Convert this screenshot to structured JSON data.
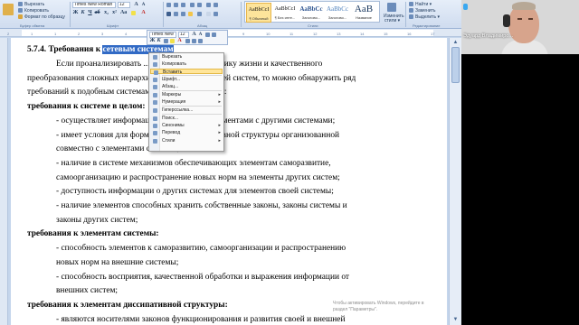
{
  "ribbon": {
    "clipboard": {
      "cut": "Вырезать",
      "copy": "Копировать",
      "format_painter": "Формат по образцу",
      "group": "Буфер обмена"
    },
    "font": {
      "name": "Times New Roman",
      "size": "12",
      "group": "Шрифт"
    },
    "paragraph_group": "Абзац",
    "styles": {
      "tiles": [
        {
          "sample": "AaBbCcI",
          "name": "¶ Обычный",
          "active": true
        },
        {
          "sample": "AaBbCcI",
          "name": "¶ Без инте..."
        },
        {
          "sample": "AaBbCc",
          "name": "Заголово..."
        },
        {
          "sample": "AaBbCc",
          "name": "Заголово..."
        },
        {
          "sample": "AaB",
          "name": "Название"
        }
      ],
      "group": "Стили"
    },
    "change_styles": {
      "line1": "Изменить",
      "line2": "стили ▾"
    },
    "editing": {
      "find": "Найти ▾",
      "replace": "Заменить",
      "select": "Выделить ▾",
      "group": "Редактирование"
    }
  },
  "ruler_marks": [
    "2",
    "1",
    "1",
    "2",
    "3",
    "4",
    "5",
    "6",
    "7",
    "8",
    "9",
    "10",
    "11",
    "12",
    "13",
    "14",
    "15",
    "16",
    "17"
  ],
  "document": {
    "heading_prefix": "5.7.4. Требования к ",
    "heading_selected": "сетевым системам",
    "lines": [
      {
        "text": "Если   проанализировать  ...   организации,   динамику  жизни  и  качественного",
        "indent": true
      },
      {
        "text": "преобразования сложных иерархических систем и сетей систем, то можно обнаружить ряд"
      },
      {
        "text": "требований к подобным системам и их составляющим:"
      },
      {
        "text": "требования к системе в целом:",
        "bold": true
      },
      {
        "text": "- осуществляет информационный и обмен элементами с другими системами;",
        "indent": true
      },
      {
        "text": "-  имеет  условия  для  формирования  диссипативной  структуры  организованной",
        "indent": true
      },
      {
        "text": "совместно с элементами системы;",
        "indent": true
      },
      {
        "text": "-   наличие   в   системе   механизмов   обеспечивающих   элементам   саморазвитие,",
        "indent": true
      },
      {
        "text": "самоорганизацию и распространение новых норм на элементы других систем;",
        "indent": true
      },
      {
        "text": "- доступность информации о других системах для элементов своей системы;",
        "indent": true
      },
      {
        "text": "-  наличие  элементов  способных  хранить  собственные  законы,  законы  системы  и",
        "indent": true
      },
      {
        "text": "законы других систем;",
        "indent": true
      },
      {
        "text": "требования  к элементам системы:",
        "bold": true
      },
      {
        "text": "-  способность  элементов  к  саморазвитию,  самоорганизации  и  распространению",
        "indent": true
      },
      {
        "text": "новых норм на внешние системы;",
        "indent": true
      },
      {
        "text": "-  способность  восприятия,  качественной  обработки  и  выражения  информации  от",
        "indent": true
      },
      {
        "text": "внешних систем;",
        "indent": true
      },
      {
        "text": "требования  к элементам диссипативной структуры:",
        "bold": true
      },
      {
        "text": "-  являются  носителями  законов  функционирования  и  развития  своей  и  внешней",
        "indent": true
      },
      {
        "text": "системы (систем);",
        "indent": true
      }
    ]
  },
  "mini_toolbar": {
    "font": "Times New",
    "size": "12"
  },
  "context_menu": {
    "items": [
      {
        "label": "Вырезать"
      },
      {
        "label": "Копировать"
      },
      {
        "label": "Вставить",
        "active": true
      },
      {
        "label": "Шрифт..."
      },
      {
        "label": "Абзац..."
      },
      {
        "label": "Маркеры",
        "submenu": true
      },
      {
        "label": "Нумерация",
        "submenu": true
      },
      {
        "label": "Гиперссылка..."
      },
      {
        "label": "Поиск..."
      },
      {
        "label": "Синонимы",
        "submenu": true
      },
      {
        "label": "Перевод",
        "submenu": true
      },
      {
        "label": "Стили",
        "submenu": true
      }
    ]
  },
  "watermark": {
    "line1": "Чтобы активировать Windows, перейдите в",
    "line2": "раздел \"Параметры\"."
  },
  "webcam": {
    "name": "Эдуард Владимиро..."
  }
}
